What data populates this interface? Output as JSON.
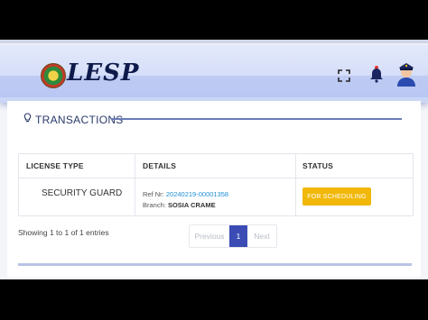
{
  "header": {
    "logo_text": "LESP",
    "icons": [
      "fullscreen-icon",
      "bell-icon",
      "police-officer-avatar"
    ]
  },
  "section": {
    "title": "TRANSACTIONS",
    "icon": "lightbulb-icon"
  },
  "table": {
    "headers": [
      "LICENSE TYPE",
      "DETAILS",
      "STATUS"
    ],
    "rows": [
      {
        "license_type": "SECURITY GUARD",
        "ref_label": "Ref Nr:",
        "ref_value": "20240219-00001358",
        "branch_label": "Branch:",
        "branch_value": "SOSIA CRAME",
        "status": "FOR SCHEDULING"
      }
    ]
  },
  "footer": {
    "entries_text": "Showing 1 to 1 of 1 entries",
    "pagination": {
      "previous": "Previous",
      "current": "1",
      "next": "Next"
    }
  },
  "colors": {
    "accent": "#3b4db4",
    "status_badge": "#f1b80a",
    "ref_link": "#1f8fd6",
    "title_rule": "#6a7bb8"
  }
}
